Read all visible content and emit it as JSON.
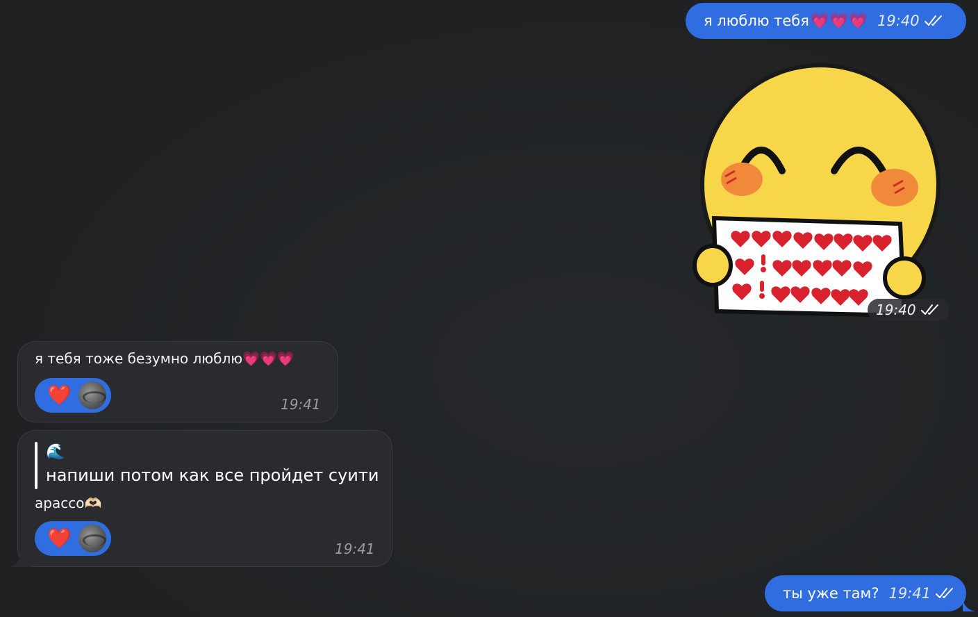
{
  "messages": {
    "m1": {
      "text": "я люблю тебя",
      "hearts": "💗💗💗",
      "time": "19:40"
    },
    "m_sticker": {
      "time": "19:40",
      "sticker": "smiling-emoji-holding-hearts-sign"
    },
    "m2": {
      "text": "я тебя тоже безумно люблю",
      "hearts": "💗💗💗",
      "reaction": "❤️",
      "time": "19:41"
    },
    "m3": {
      "quote_emoji": "🌊",
      "quote_text": "напиши потом как все пройдет суити",
      "text": "apacco",
      "text_emoji": "🫶🏻",
      "reaction": "❤️",
      "time": "19:41"
    },
    "m4": {
      "text": "ты уже там?",
      "time": "19:41"
    }
  },
  "colors": {
    "background": "#202124",
    "outgoing_bubble": "#2f6de0",
    "incoming_bubble": "#2a2b2e",
    "sticker_face": "#f7d64a",
    "sticker_cheeks": "#f08a3a",
    "hearts": "#d8232f"
  }
}
